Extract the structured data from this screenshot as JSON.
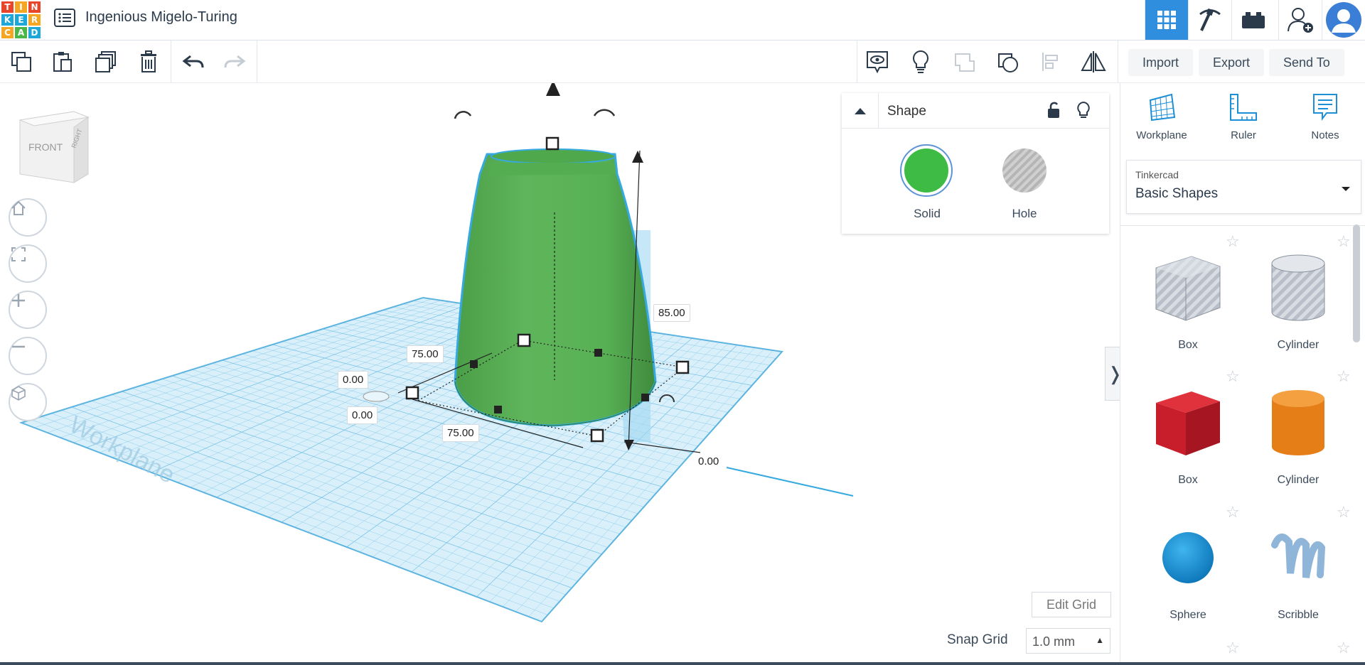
{
  "app": {
    "logo_letters": [
      "T",
      "I",
      "N",
      "K",
      "E",
      "R",
      "C",
      "A",
      "D"
    ],
    "logo_colors": [
      "#e8452a",
      "#f5a623",
      "#e8452a",
      "#1ea7d9",
      "#1ea7d9",
      "#f5a623",
      "#f5a623",
      "#4bb749",
      "#1ea7d9"
    ],
    "title": "Ingenious Migelo-Turing"
  },
  "topbar_right": {
    "buttons": [
      {
        "name": "3d-design-grid-icon",
        "active": true
      },
      {
        "name": "pickaxe-icon",
        "active": false
      },
      {
        "name": "bricks-icon",
        "active": false
      },
      {
        "name": "add-user-icon",
        "active": false
      },
      {
        "name": "avatar-icon",
        "active": false
      }
    ]
  },
  "toolbar": {
    "left_icons": [
      "copy-icon",
      "paste-icon",
      "duplicate-icon",
      "delete-icon",
      "undo-icon",
      "redo-icon"
    ],
    "right_icons": [
      "comment-view-icon",
      "light-bulb-icon",
      "group-icon",
      "ungroup-icon",
      "align-icon",
      "mirror-icon"
    ],
    "import_label": "Import",
    "export_label": "Export",
    "send_to_label": "Send To"
  },
  "viewcube": {
    "front": "FRONT",
    "right": "RIGHT"
  },
  "dimensions": {
    "height": "85.00",
    "width_top": "75.00",
    "width_bottom": "75.00",
    "pos_x": "0.00",
    "pos_y": "0.00",
    "elevation": "0.00"
  },
  "workplane_text": "Workplane",
  "shape_panel": {
    "title": "Shape",
    "solid_label": "Solid",
    "hole_label": "Hole",
    "solid_color": "#3dbb45"
  },
  "right_panel": {
    "tools": [
      {
        "label": "Workplane",
        "icon": "workplane-icon"
      },
      {
        "label": "Ruler",
        "icon": "ruler-icon"
      },
      {
        "label": "Notes",
        "icon": "notes-icon"
      }
    ],
    "library_category": "Tinkercad",
    "library_name": "Basic Shapes",
    "shapes": [
      {
        "name": "Box",
        "kind": "box-hole"
      },
      {
        "name": "Cylinder",
        "kind": "cylinder-hole"
      },
      {
        "name": "Box",
        "kind": "box-red"
      },
      {
        "name": "Cylinder",
        "kind": "cylinder-orange"
      },
      {
        "name": "Sphere",
        "kind": "sphere-blue"
      },
      {
        "name": "Scribble",
        "kind": "scribble"
      }
    ]
  },
  "bottom": {
    "edit_grid_label": "Edit Grid",
    "snap_grid_label": "Snap Grid",
    "snap_grid_value": "1.0 mm"
  }
}
